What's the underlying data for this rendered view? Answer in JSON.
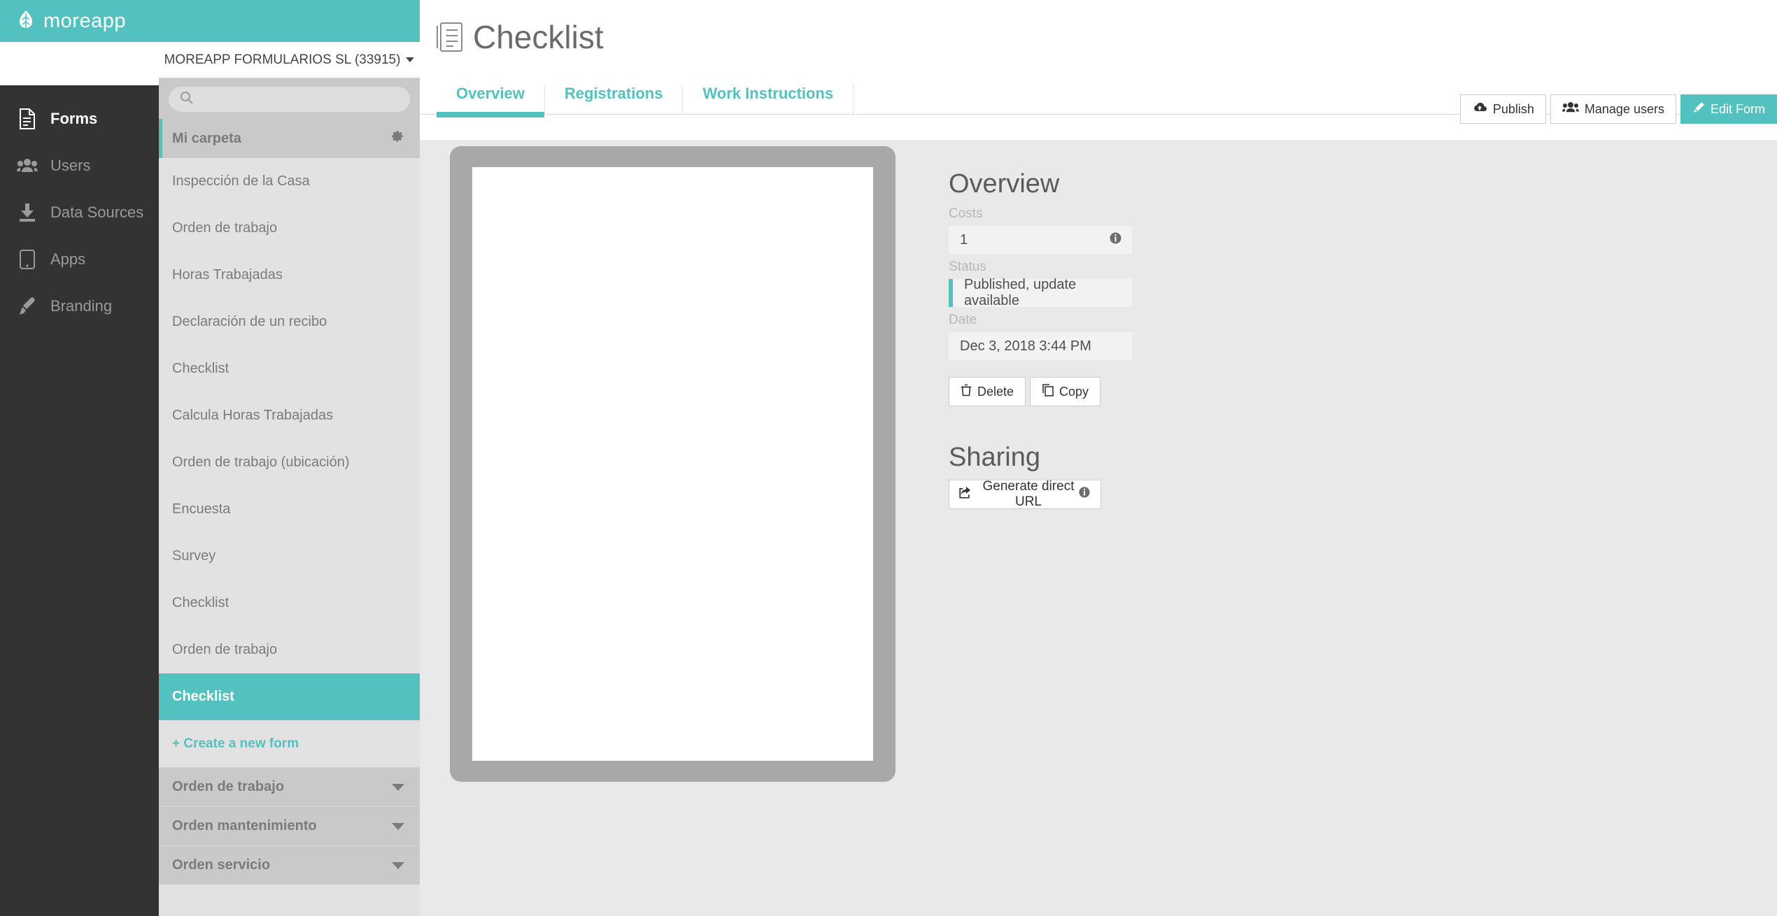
{
  "brand": {
    "name": "moreapp",
    "logo_icon": "leaf-icon"
  },
  "account": {
    "name": "MOREAPP FORMULARIOS SL (33915)",
    "caret_icon": "chevron-down-icon"
  },
  "rail": {
    "items": [
      {
        "label": "Forms",
        "icon": "document-icon",
        "active": true
      },
      {
        "label": "Users",
        "icon": "users-icon",
        "active": false
      },
      {
        "label": "Data Sources",
        "icon": "download-icon",
        "active": false
      },
      {
        "label": "Apps",
        "icon": "tablet-icon",
        "active": false
      },
      {
        "label": "Branding",
        "icon": "paintbrush-icon",
        "active": false
      }
    ]
  },
  "forms_panel": {
    "search": {
      "placeholder": "",
      "value": "",
      "icon": "search-icon"
    },
    "folder": {
      "label": "Mi carpeta",
      "settings_icon": "gear-icon"
    },
    "forms": [
      {
        "label": "Inspección de la Casa",
        "selected": false
      },
      {
        "label": "Orden de trabajo",
        "selected": false
      },
      {
        "label": "Horas Trabajadas",
        "selected": false
      },
      {
        "label": "Declaración de un recibo",
        "selected": false
      },
      {
        "label": "Checklist",
        "selected": false
      },
      {
        "label": "Calcula Horas Trabajadas",
        "selected": false
      },
      {
        "label": "Orden de trabajo (ubicación)",
        "selected": false
      },
      {
        "label": "Encuesta",
        "selected": false
      },
      {
        "label": "Survey",
        "selected": false
      },
      {
        "label": "Checklist",
        "selected": false
      },
      {
        "label": "Orden de trabajo",
        "selected": false
      },
      {
        "label": "Checklist",
        "selected": true
      }
    ],
    "create_new_label": "+ Create a new form",
    "collapsed_folders": [
      {
        "label": "Orden de trabajo",
        "caret_icon": "caret-down-icon"
      },
      {
        "label": "Orden mantenimiento",
        "caret_icon": "caret-down-icon"
      },
      {
        "label": "Orden servicio",
        "caret_icon": "caret-down-icon"
      }
    ]
  },
  "header": {
    "title": "Checklist",
    "title_icon": "form-document-icon",
    "tabs": [
      {
        "label": "Overview",
        "active": true
      },
      {
        "label": "Registrations",
        "active": false
      },
      {
        "label": "Work Instructions",
        "active": false
      }
    ],
    "actions": [
      {
        "label": "Publish",
        "icon": "cloud-upload-icon",
        "primary": false
      },
      {
        "label": "Manage users",
        "icon": "users-icon",
        "primary": false
      },
      {
        "label": "Edit Form",
        "icon": "pencil-icon",
        "primary": true
      }
    ]
  },
  "overview": {
    "title": "Overview",
    "costs_label": "Costs",
    "costs_value": "1",
    "costs_info_icon": "info-icon",
    "status_label": "Status",
    "status_value": "Published, update available",
    "date_label": "Date",
    "date_value": "Dec 3, 2018 3:44 PM",
    "delete_label": "Delete",
    "delete_icon": "trash-icon",
    "copy_label": "Copy",
    "copy_icon": "copy-icon"
  },
  "sharing": {
    "title": "Sharing",
    "generate_label": "Generate direct URL",
    "generate_icon": "external-link-icon",
    "info_icon": "info-icon"
  },
  "colors": {
    "accent": "#53c1bf",
    "rail_bg": "#333333",
    "panel_bg": "#e2e2e2",
    "content_bg": "#e9e9e9",
    "device_frame": "#a8a8a8"
  }
}
